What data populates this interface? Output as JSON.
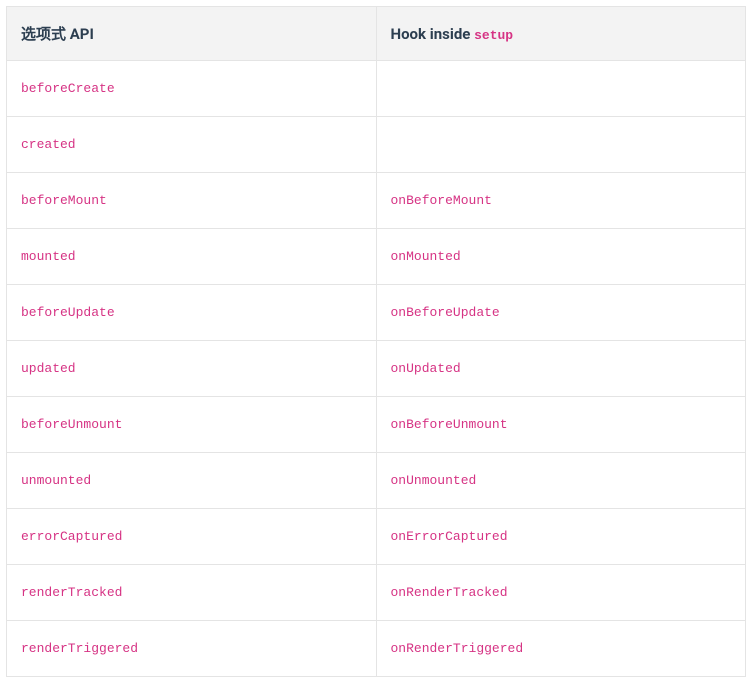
{
  "table": {
    "header": {
      "col1_label": "选项式 API",
      "col2_label_prefix": "Hook inside ",
      "col2_label_code": "setup"
    },
    "rows": [
      {
        "option": "beforeCreate",
        "hook": ""
      },
      {
        "option": "created",
        "hook": ""
      },
      {
        "option": "beforeMount",
        "hook": "onBeforeMount"
      },
      {
        "option": "mounted",
        "hook": "onMounted"
      },
      {
        "option": "beforeUpdate",
        "hook": "onBeforeUpdate"
      },
      {
        "option": "updated",
        "hook": "onUpdated"
      },
      {
        "option": "beforeUnmount",
        "hook": "onBeforeUnmount"
      },
      {
        "option": "unmounted",
        "hook": "onUnmounted"
      },
      {
        "option": "errorCaptured",
        "hook": "onErrorCaptured"
      },
      {
        "option": "renderTracked",
        "hook": "onRenderTracked"
      },
      {
        "option": "renderTriggered",
        "hook": "onRenderTriggered"
      }
    ]
  }
}
